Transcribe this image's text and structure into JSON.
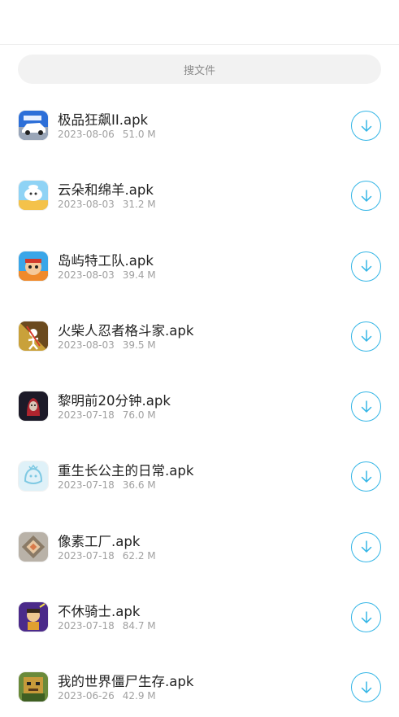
{
  "search": {
    "placeholder": "搜文件"
  },
  "colors": {
    "accent": "#35b6e6",
    "text": "#222222",
    "meta": "#a0a0a0"
  },
  "files": [
    {
      "name": "极品狂飙II.apk",
      "date": "2023-08-06",
      "size": "51.0 M",
      "icon": "racing-car-icon"
    },
    {
      "name": "云朵和绵羊.apk",
      "date": "2023-08-03",
      "size": "31.2 M",
      "icon": "cloud-sheep-icon"
    },
    {
      "name": "岛屿特工队.apk",
      "date": "2023-08-03",
      "size": "39.4 M",
      "icon": "island-agent-icon"
    },
    {
      "name": "火柴人忍者格斗家.apk",
      "date": "2023-08-03",
      "size": "39.5 M",
      "icon": "stickman-ninja-icon"
    },
    {
      "name": "黎明前20分钟.apk",
      "date": "2023-07-18",
      "size": "76.0 M",
      "icon": "dawn-icon"
    },
    {
      "name": "重生长公主的日常.apk",
      "date": "2023-07-18",
      "size": "36.6 M",
      "icon": "princess-icon"
    },
    {
      "name": "像素工厂.apk",
      "date": "2023-07-18",
      "size": "62.2 M",
      "icon": "pixel-factory-icon"
    },
    {
      "name": "不休骑士.apk",
      "date": "2023-07-18",
      "size": "84.7 M",
      "icon": "knight-icon"
    },
    {
      "name": "我的世界僵尸生存.apk",
      "date": "2023-06-26",
      "size": "42.9 M",
      "icon": "zombie-survival-icon"
    }
  ]
}
